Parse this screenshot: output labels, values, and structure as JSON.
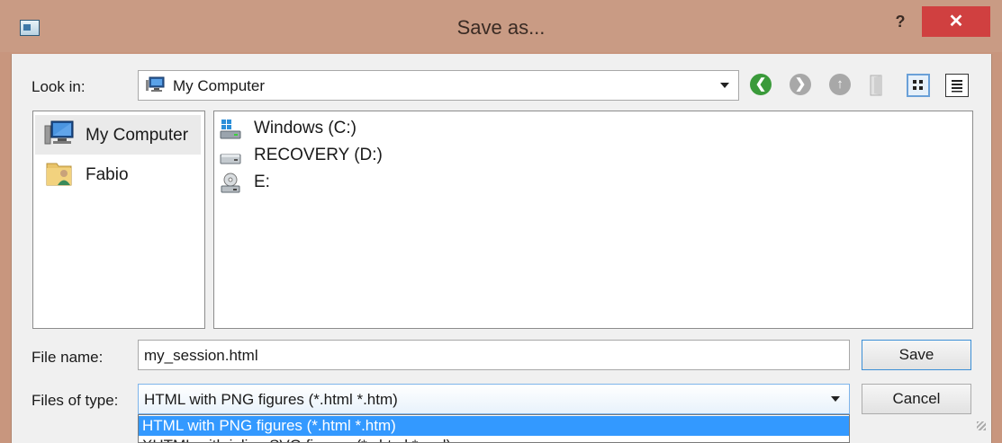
{
  "window": {
    "title": "Save as...",
    "help_label": "?",
    "close_label": "✕"
  },
  "look_in": {
    "label": "Look in:",
    "value": "My Computer"
  },
  "places": [
    {
      "label": "My Computer",
      "icon": "computer-icon",
      "selected": true
    },
    {
      "label": "Fabio",
      "icon": "user-folder-icon",
      "selected": false
    }
  ],
  "drives": [
    {
      "label": "Windows (C:)",
      "icon": "windows-drive-icon"
    },
    {
      "label": "RECOVERY (D:)",
      "icon": "hard-drive-icon"
    },
    {
      "label": "E:",
      "icon": "optical-drive-icon"
    }
  ],
  "file_name": {
    "label": "File name:",
    "value": "my_session.html"
  },
  "file_type": {
    "label": "Files of type:",
    "value": "HTML with PNG figures (*.html *.htm)",
    "options": [
      "HTML with PNG figures (*.html *.htm)",
      "XHTML with inline SVG figures (*.xhtml *.xml)"
    ]
  },
  "buttons": {
    "save": "Save",
    "cancel": "Cancel"
  },
  "colors": {
    "titlebar": "#c99b84",
    "close": "#d04040",
    "highlight": "#3399ff"
  }
}
